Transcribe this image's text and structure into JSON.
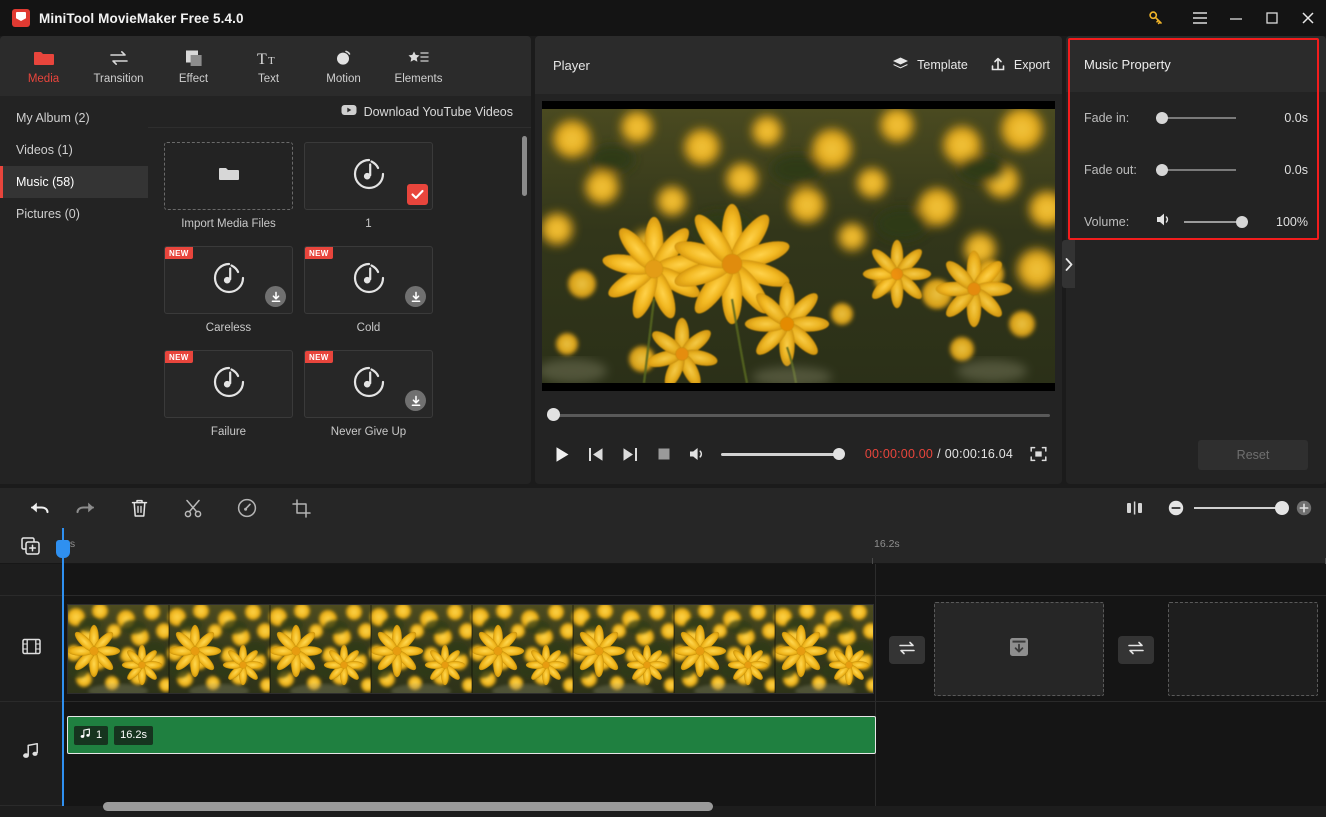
{
  "window": {
    "title": "MiniTool MovieMaker Free 5.4.0",
    "controls": {
      "key": "key-icon",
      "menu": "hamburger-icon",
      "minimize": "minimize-icon",
      "maximize": "maximize-icon",
      "close": "close-icon"
    }
  },
  "tabs": [
    {
      "label": "Media",
      "icon": "folder-icon",
      "active": true
    },
    {
      "label": "Transition",
      "icon": "transition-arrows-icon",
      "active": false
    },
    {
      "label": "Effect",
      "icon": "layers-square-icon",
      "active": false
    },
    {
      "label": "Text",
      "icon": "text-tt-icon",
      "active": false
    },
    {
      "label": "Motion",
      "icon": "motion-circle-icon",
      "active": false
    },
    {
      "label": "Elements",
      "icon": "star-list-icon",
      "active": false
    }
  ],
  "categories": [
    {
      "label": "My Album (2)",
      "active": false
    },
    {
      "label": "Videos (1)",
      "active": false
    },
    {
      "label": "Music (58)",
      "active": true
    },
    {
      "label": "Pictures (0)",
      "active": false
    }
  ],
  "media": {
    "download_youtube": "Download YouTube Videos",
    "items": [
      {
        "label": "Import Media Files",
        "kind": "import",
        "new": false,
        "selected": false,
        "download": false
      },
      {
        "label": "1",
        "kind": "music",
        "new": false,
        "selected": true,
        "download": false
      },
      {
        "label": "Careless",
        "kind": "music",
        "new": true,
        "selected": false,
        "download": true
      },
      {
        "label": "Cold",
        "kind": "music",
        "new": true,
        "selected": false,
        "download": true
      },
      {
        "label": "Failure",
        "kind": "music",
        "new": true,
        "selected": false,
        "download": false
      },
      {
        "label": "Never Give Up",
        "kind": "music",
        "new": true,
        "selected": false,
        "download": true
      }
    ]
  },
  "player": {
    "title": "Player",
    "template_label": "Template",
    "export_label": "Export",
    "current_time": "00:00:00.00",
    "separator": "/",
    "total_time": "00:00:16.04",
    "seek_percent": 0,
    "volume_percent": 100,
    "current_time_color": "#e8453c"
  },
  "property": {
    "title": "Music Property",
    "rows": [
      {
        "label": "Fade in:",
        "value": "0.0s",
        "percent": 0
      },
      {
        "label": "Fade out:",
        "value": "0.0s",
        "percent": 0
      }
    ],
    "volume": {
      "label": "Volume:",
      "value": "100%",
      "percent": 100
    },
    "reset_label": "Reset",
    "highlight_color": "#f21d1d"
  },
  "timeline": {
    "toolbar": [
      {
        "name": "undo-icon"
      },
      {
        "name": "redo-icon"
      },
      {
        "name": "delete-icon"
      },
      {
        "name": "split-scissors-icon"
      },
      {
        "name": "speed-gauge-icon"
      },
      {
        "name": "crop-icon"
      }
    ],
    "toolbar_right": [
      {
        "name": "fit-timeline-icon"
      },
      {
        "name": "zoom-out-icon"
      },
      {
        "name": "zoom-in-icon"
      }
    ],
    "zoom_percent": 100,
    "ruler": {
      "start_label": "0s",
      "end_label": "16.2s"
    },
    "tracks": [
      {
        "name": "text-track",
        "icon": null
      },
      {
        "name": "video-track",
        "icon": "film-strip-icon"
      },
      {
        "name": "audio-track",
        "icon": "music-note-icon"
      }
    ],
    "video_clip": {
      "thumbnails": 8
    },
    "audio_clip": {
      "index_label": "1",
      "duration_label": "16.2s",
      "icon": "music-note-icon",
      "color": "#1f8040"
    },
    "transition_slots": [
      {
        "name": "transition-slot-1",
        "icon": "transition-arrows-icon"
      },
      {
        "name": "transition-slot-2",
        "icon": "transition-arrows-icon"
      }
    ],
    "placeholder_slots": [
      {
        "name": "media-drop-placeholder",
        "icon": "download-box-icon"
      },
      {
        "name": "empty-placeholder",
        "icon": null
      }
    ],
    "playhead_label": "0s"
  }
}
